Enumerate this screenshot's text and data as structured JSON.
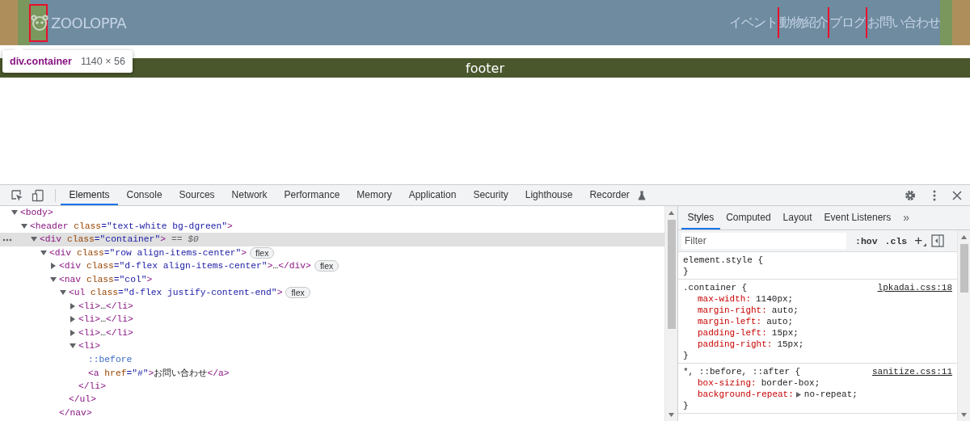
{
  "page": {
    "header": {
      "logo": "ZOOLOPPA",
      "nav": [
        "イベント",
        "動物紹介",
        "ブログ",
        "お問い合わせ"
      ]
    },
    "tooltip": {
      "selector": "div.container",
      "size": "1140 × 56"
    },
    "footer": {
      "text": "footer"
    }
  },
  "devtools": {
    "tabs": [
      {
        "label": "Elements",
        "selected": true
      },
      {
        "label": "Console",
        "selected": false
      },
      {
        "label": "Sources",
        "selected": false
      },
      {
        "label": "Network",
        "selected": false
      },
      {
        "label": "Performance",
        "selected": false
      },
      {
        "label": "Memory",
        "selected": false
      },
      {
        "label": "Application",
        "selected": false
      },
      {
        "label": "Security",
        "selected": false
      },
      {
        "label": "Lighthouse",
        "selected": false
      },
      {
        "label": "Recorder",
        "selected": false
      }
    ],
    "tree": [
      {
        "text": "<body>",
        "expanded": true,
        "selected": false,
        "children": [
          {
            "text": "<header class=\"text-white bg-dgreen\">",
            "expanded": true,
            "selected": false,
            "children": [
              {
                "text": "<div class=\"container\">",
                "expanded": true,
                "selected": true,
                "suffix": "== $0",
                "children": [
                  {
                    "text": "<div class=\"row align-items-center\">",
                    "expanded": true,
                    "selected": false,
                    "badge": "flex",
                    "children": [
                      {
                        "text": "<div class=\"d-flex align-items-center\">…</div>",
                        "expanded": false,
                        "selected": false,
                        "badge": "flex"
                      },
                      {
                        "text": "<nav class=\"col\">",
                        "expanded": true,
                        "selected": false,
                        "children": [
                          {
                            "text": "<ul class=\"d-flex justify-content-end\">",
                            "expanded": true,
                            "selected": false,
                            "badge": "flex",
                            "children": [
                              {
                                "text": "<li>…</li>",
                                "expanded": false,
                                "selected": false
                              },
                              {
                                "text": "<li>…</li>",
                                "expanded": false,
                                "selected": false
                              },
                              {
                                "text": "<li>…</li>",
                                "expanded": false,
                                "selected": false
                              },
                              {
                                "text": "<li>",
                                "expanded": true,
                                "selected": false,
                                "closing": "</li>",
                                "children": [
                                  {
                                    "text": "::before",
                                    "kind": "pseudo",
                                    "selected": false
                                  },
                                  {
                                    "text": "<a href=\"#\">お問い合わせ</a>",
                                    "kind": "element",
                                    "selected": false
                                  }
                                ]
                              }
                            ],
                            "closing": "</ul>"
                          }
                        ],
                        "closing": "</nav>"
                      }
                    ]
                  }
                ]
              }
            ]
          }
        ]
      }
    ],
    "sidebar_tabs": [
      {
        "label": "Styles",
        "selected": true
      },
      {
        "label": "Computed",
        "selected": false
      },
      {
        "label": "Layout",
        "selected": false
      },
      {
        "label": "Event Listeners",
        "selected": false
      }
    ],
    "more_tabs": "»",
    "filter": {
      "placeholder": "Filter"
    },
    "filter_buttons": [
      ":hov",
      ".cls",
      "+"
    ],
    "rules": [
      {
        "selector": "element.style {",
        "close": "}"
      },
      {
        "selector": ".container {",
        "source": "lpkadai.css:18",
        "properties": [
          {
            "name": "max-width:",
            "value": "1140px;"
          },
          {
            "name": "margin-right:",
            "value": "auto;"
          },
          {
            "name": "margin-left:",
            "value": "auto;"
          },
          {
            "name": "padding-left:",
            "value": "15px;"
          },
          {
            "name": "padding-right:",
            "value": "15px;"
          }
        ],
        "close": "}"
      },
      {
        "selector": "*, ::before, ::after {",
        "source": "sanitize.css:11",
        "properties": [
          {
            "name": "box-sizing:",
            "value": "border-box;",
            "expandable": false
          },
          {
            "name": "background-repeat:",
            "value": "no-repeat;",
            "expandable": true
          }
        ],
        "close": "}"
      }
    ]
  }
}
